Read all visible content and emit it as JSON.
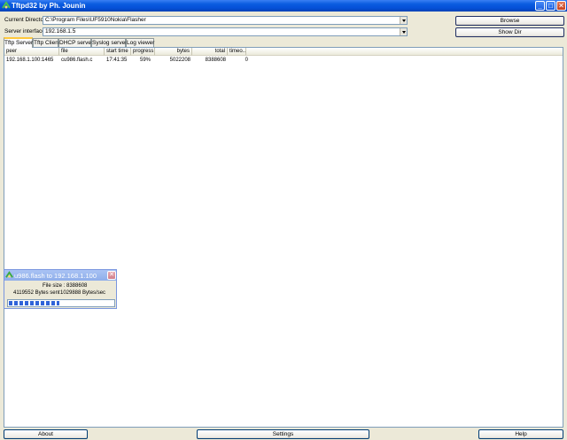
{
  "window": {
    "title": "Tftpd32 by Ph. Jounin"
  },
  "titlebar_buttons": {
    "minimize": "_",
    "maximize": "□",
    "close": "✕"
  },
  "form": {
    "current_directory_label": "Current Directory",
    "current_directory_value": "C:\\Program Files\\UF5910Nokia\\Flasher",
    "server_interfaces_label": "Server interfaces",
    "server_interfaces_value": "192.168.1.5",
    "browse_label": "Browse",
    "show_dir_label": "Show Dir"
  },
  "tabs": [
    {
      "label": "Tftp Server",
      "active": true
    },
    {
      "label": "Tftp Client",
      "active": false
    },
    {
      "label": "DHCP server",
      "active": false
    },
    {
      "label": "Syslog server",
      "active": false
    },
    {
      "label": "Log viewer",
      "active": false
    }
  ],
  "table": {
    "columns": [
      "peer",
      "file",
      "start time",
      "progress",
      "bytes",
      "total",
      "timeo..."
    ],
    "rows": [
      [
        "192.168.1.100:1465",
        "cu986.flash.c",
        "17:41:35",
        "59%",
        "5022208",
        "8388608",
        "0"
      ]
    ]
  },
  "transfer_popup": {
    "title": "u986.flash to 192.168.1.100",
    "file_size_text": "File size : 8388608",
    "bytes_sent_text": "4119552 Bytes sent",
    "rate_text": "1029888 Bytes/sec",
    "progress_percent": 49
  },
  "bottom_buttons": {
    "about": "About",
    "settings": "Settings",
    "help": "Help"
  },
  "icons": {
    "app": "tftpd-app-icon",
    "popup": "transfer-icon",
    "combo_arrow": "chevron-down-icon"
  },
  "colors": {
    "titlebar": "#0A5CE0",
    "popup_titlebar": "#8FAEEA",
    "progress": "#2F63D8",
    "window_bg": "#ECE9D8",
    "tab_highlight": "#FFC83C"
  }
}
